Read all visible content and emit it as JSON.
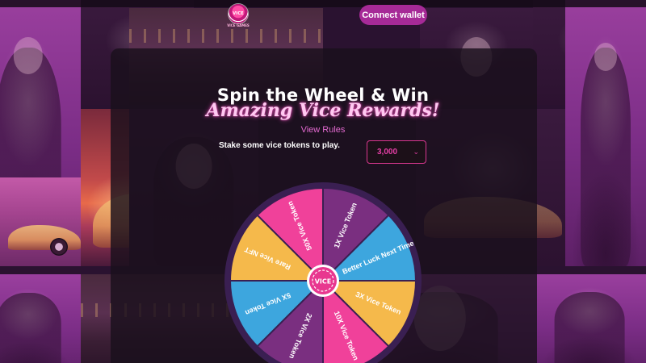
{
  "header": {
    "logo_text": "VICE",
    "logo_caption": "VICE GAMES",
    "connect_wallet_label": "Connect wallet"
  },
  "hero": {
    "title_line1": "Spin the Wheel & Win",
    "title_line2": "Amazing Vice Rewards!",
    "view_rules_label": "View Rules"
  },
  "stake": {
    "prompt": "Stake some vice tokens to play.",
    "selected_amount": "3,000"
  },
  "wheel": {
    "center_label": "VICE",
    "colors": {
      "pink": "#f0419a",
      "purple": "#7a2f80",
      "blue": "#3da6de",
      "yellow": "#f5b94b",
      "rim": "#3a1f52",
      "hub": "#e8378f"
    },
    "segments": [
      {
        "label": "1X Vice Token",
        "color": "#7a2f80"
      },
      {
        "label": "Better Luck Next Time",
        "color": "#3da6de"
      },
      {
        "label": "3X Vice Token",
        "color": "#f5b94b"
      },
      {
        "label": "10X Vice Token",
        "color": "#f0419a"
      },
      {
        "label": "2X Vice Token",
        "color": "#7a2f80"
      },
      {
        "label": "5X Vice Token",
        "color": "#3da6de"
      },
      {
        "label": "Rare Vice NFT",
        "color": "#f5b94b"
      },
      {
        "label": "50X Vice Token",
        "color": "#f0419a"
      }
    ]
  }
}
